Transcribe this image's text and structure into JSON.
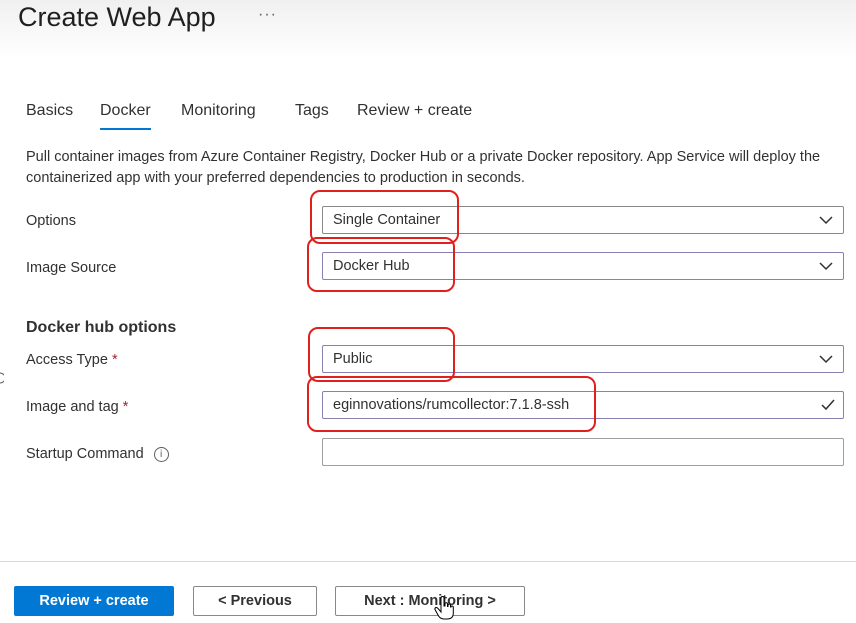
{
  "header": {
    "title": "Create Web App",
    "more_label": "···"
  },
  "tabs": [
    {
      "label": "Basics",
      "active": false
    },
    {
      "label": "Docker",
      "active": true
    },
    {
      "label": "Monitoring",
      "active": false
    },
    {
      "label": "Tags",
      "active": false
    },
    {
      "label": "Review + create",
      "active": false
    }
  ],
  "description": "Pull container images from Azure Container Registry, Docker Hub or a private Docker repository. App Service will deploy the containerized app with your preferred dependencies to production in seconds.",
  "form": {
    "options": {
      "label": "Options",
      "value": "Single Container"
    },
    "image_source": {
      "label": "Image Source",
      "value": "Docker Hub"
    },
    "section_heading": "Docker hub options",
    "access_type": {
      "label": "Access Type",
      "required_mark": "*",
      "value": "Public"
    },
    "image_and_tag": {
      "label": "Image and tag",
      "required_mark": "*",
      "value": "eginnovations/rumcollector:7.1.8-ssh"
    },
    "startup_command": {
      "label": "Startup Command",
      "info_glyph": "i",
      "value": ""
    }
  },
  "footer": {
    "review_create_label": "Review + create",
    "previous_label": "< Previous",
    "next_label": "Next : Monitoring >"
  },
  "colors": {
    "accent": "#0078d4",
    "annotation": "#e0201d",
    "required": "#a4262c"
  },
  "icons": {
    "more": "more-icon",
    "dropdown": "chevron-down-icon",
    "valid": "checkmark-icon",
    "info": "info-icon",
    "cursor": "hand-cursor-icon"
  }
}
